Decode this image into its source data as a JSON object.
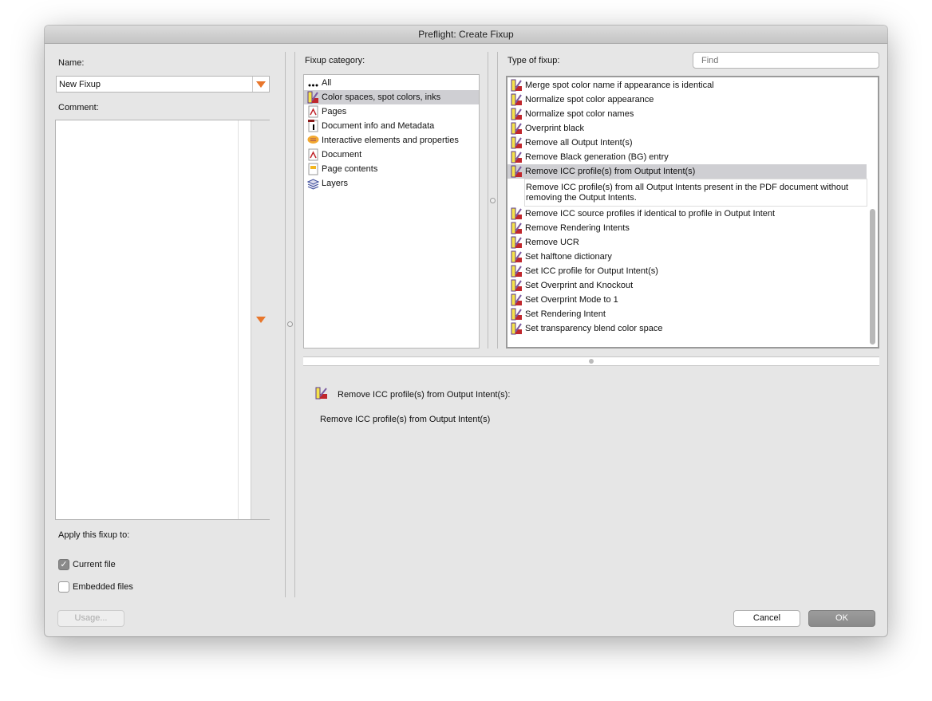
{
  "window": {
    "title": "Preflight: Create Fixup"
  },
  "left": {
    "name_label": "Name:",
    "name_value": "New Fixup",
    "comment_label": "Comment:",
    "apply_label": "Apply this fixup to:",
    "current_file": "Current file",
    "current_file_checked": true,
    "embedded_files": "Embedded files",
    "embedded_files_checked": false,
    "usage_button": "Usage..."
  },
  "category": {
    "label": "Fixup category:",
    "items": [
      {
        "label": "All",
        "icon": "dots-icon"
      },
      {
        "label": "Color spaces, spot colors, inks",
        "icon": "color-icon",
        "selected": true
      },
      {
        "label": "Pages",
        "icon": "pdf-icon"
      },
      {
        "label": "Document info and Metadata",
        "icon": "info-icon"
      },
      {
        "label": "Interactive elements and properties",
        "icon": "comment-icon"
      },
      {
        "label": "Document",
        "icon": "pdf-icon"
      },
      {
        "label": "Page contents",
        "icon": "page-contents-icon"
      },
      {
        "label": "Layers",
        "icon": "layers-icon"
      }
    ]
  },
  "types": {
    "label": "Type of fixup:",
    "find_placeholder": "Find",
    "items": [
      "Merge spot color name if appearance is identical",
      "Normalize spot color appearance",
      "Normalize spot color names",
      "Overprint black",
      "Remove all Output Intent(s)",
      "Remove Black generation (BG) entry",
      "Remove ICC profile(s) from Output Intent(s)",
      "Remove ICC source profiles if identical to profile in Output Intent",
      "Remove Rendering Intents",
      "Remove UCR",
      "Set halftone dictionary",
      "Set ICC profile for Output Intent(s)",
      "Set Overprint and Knockout",
      "Set Overprint Mode to 1",
      "Set Rendering Intent",
      "Set transparency blend color space"
    ],
    "selected_index": 6,
    "selected_description": "Remove ICC profile(s) from all Output Intents present in the PDF document without removing the Output Intents."
  },
  "detail": {
    "title": "Remove ICC profile(s) from Output Intent(s):",
    "description": "Remove ICC profile(s) from Output Intent(s)"
  },
  "buttons": {
    "cancel": "Cancel",
    "ok": "OK"
  }
}
